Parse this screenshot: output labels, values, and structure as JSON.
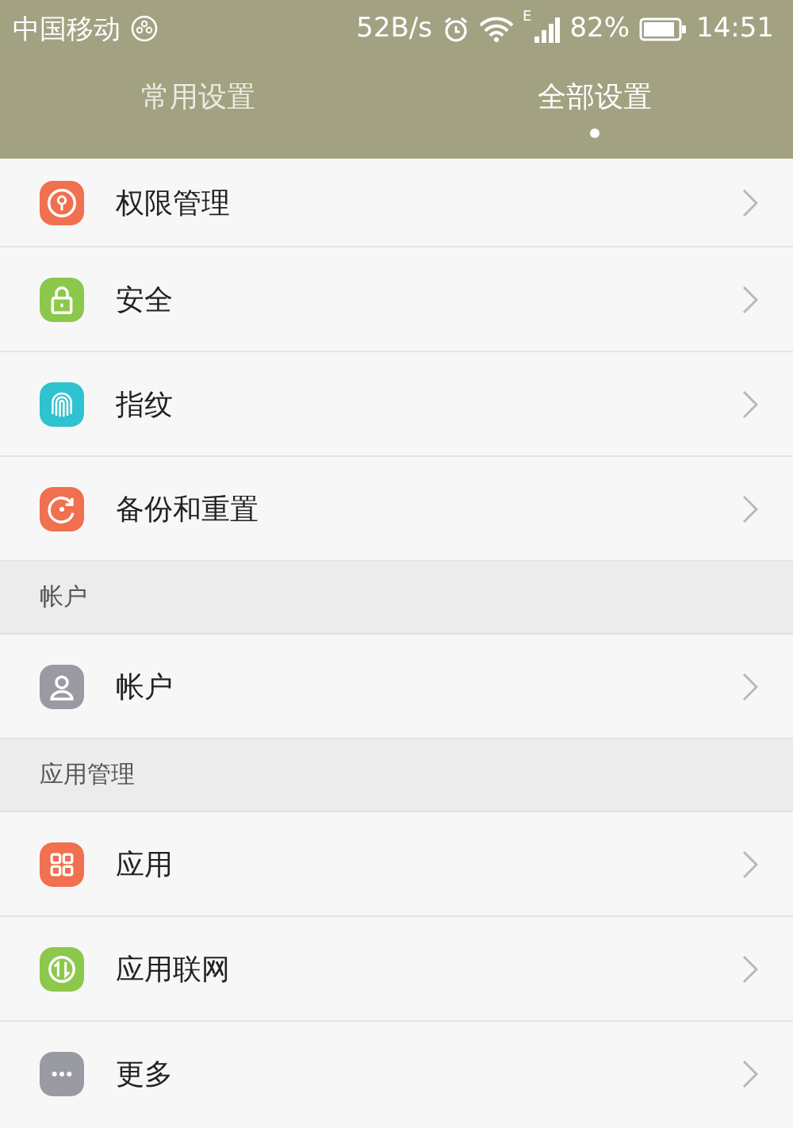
{
  "status_bar": {
    "carrier": "中国移动",
    "speed": "52B/s",
    "network_type": "E",
    "battery": "82%",
    "time": "14:51"
  },
  "tabs": [
    {
      "label": "常用设置",
      "selected": false
    },
    {
      "label": "全部设置",
      "selected": true
    }
  ],
  "sections": [
    {
      "items": [
        {
          "label": "权限管理",
          "color": "#f0704f"
        },
        {
          "label": "安全",
          "color": "#8cc84b"
        },
        {
          "label": "指纹",
          "color": "#2fc2d0"
        },
        {
          "label": "备份和重置",
          "color": "#f0704f"
        }
      ]
    },
    {
      "header": "帐户",
      "items": [
        {
          "label": "帐户",
          "color": "#9a9aa2"
        }
      ]
    },
    {
      "header": "应用管理",
      "items": [
        {
          "label": "应用",
          "color": "#f0704f"
        },
        {
          "label": "应用联网",
          "color": "#8cc84b"
        },
        {
          "label": "更多",
          "color": "#9a9aa2"
        }
      ]
    }
  ]
}
